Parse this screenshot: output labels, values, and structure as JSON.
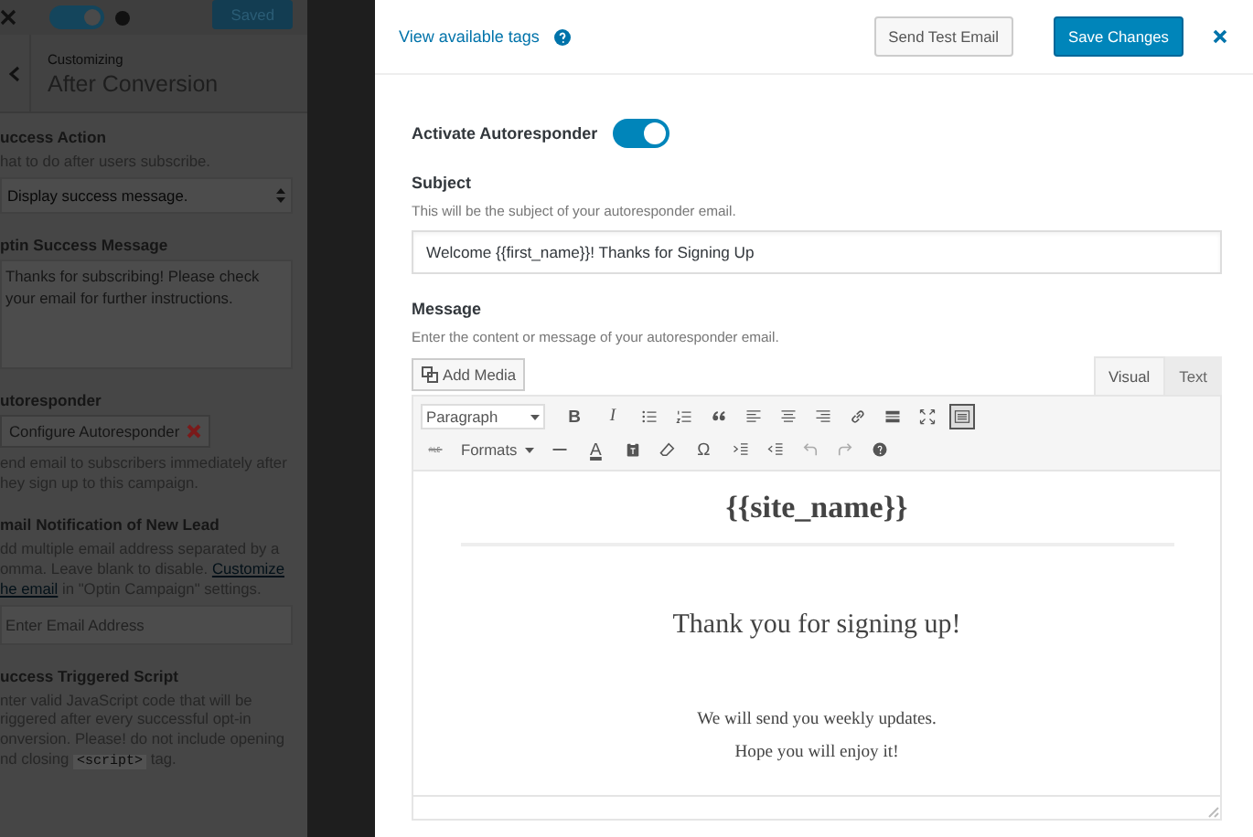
{
  "customizer": {
    "toggle": {
      "on": true
    },
    "saved_button": "Saved",
    "header": {
      "subtitle": "Customizing",
      "title": "After Conversion"
    },
    "fields": [
      {
        "kind": "select",
        "label": "uccess Action",
        "lines": [
          [
            {
              "kind": "text",
              "text": "hat to do after users subscribe."
            }
          ]
        ],
        "value": "Display success message."
      },
      {
        "kind": "textarea",
        "label": "ptin Success Message",
        "value": "Thanks for subscribing! Please check your email for further instructions."
      },
      {
        "kind": "button",
        "label": "utoresponder",
        "button": "Configure Autoresponder",
        "lines": [
          [
            {
              "kind": "text",
              "text": "end email to subscribers immediately after"
            }
          ],
          [
            {
              "kind": "text",
              "text": "hey sign up to this campaign."
            }
          ]
        ]
      },
      {
        "kind": "input",
        "label": "mail Notification of New Lead",
        "lines": [
          [
            {
              "kind": "text",
              "text": "dd multiple email address separated by a"
            }
          ],
          [
            {
              "kind": "text",
              "text": "omma. Leave blank to disable."
            },
            {
              "kind": "link",
              "text": "Customize"
            }
          ],
          [
            {
              "kind": "link",
              "text": "he email"
            },
            {
              "kind": "text",
              "text": "in \"Optin Campaign\" settings."
            }
          ]
        ],
        "placeholder": "Enter Email Address"
      },
      {
        "kind": "code",
        "label": "uccess Triggered Script",
        "lines": [
          [
            {
              "kind": "text",
              "text": "nter valid JavaScript code that will be"
            }
          ],
          [
            {
              "kind": "text",
              "text": "riggered after every successful opt-in"
            }
          ],
          [
            {
              "kind": "text",
              "text": "onversion. Please! do not include opening"
            }
          ],
          [
            {
              "kind": "text",
              "text": "nd closing"
            },
            {
              "kind": "code",
              "text": "<script>"
            },
            {
              "kind": "text",
              "text": "tag."
            }
          ]
        ]
      }
    ]
  },
  "modal": {
    "tags_link": "View available tags",
    "send_test_button": "Send Test Email",
    "save_button": "Save Changes",
    "activate": {
      "label": "Activate Autoresponder",
      "on": true
    },
    "subject": {
      "label": "Subject",
      "description": "This will be the subject of your autoresponder email.",
      "value": "Welcome {{first_name}}! Thanks for Signing Up"
    },
    "message": {
      "label": "Message",
      "description": "Enter the content or message of your autoresponder email.",
      "add_media_button": "Add Media",
      "tabs": [
        {
          "label": "Visual",
          "selected": true
        },
        {
          "label": "Text",
          "selected": false
        }
      ],
      "toolbar_rows": [
        [
          {
            "kind": "dropdown",
            "label": "Paragraph",
            "pressed": false
          },
          {
            "kind": "glyph",
            "label": "B",
            "pressed": false
          },
          {
            "kind": "glyph",
            "label": "I",
            "pressed": false
          },
          {
            "kind": "icon",
            "pressed": false
          },
          {
            "kind": "icon",
            "pressed": false
          },
          {
            "kind": "icon",
            "pressed": false
          },
          {
            "kind": "icon",
            "pressed": false
          },
          {
            "kind": "icon",
            "pressed": false
          },
          {
            "kind": "icon",
            "pressed": false
          },
          {
            "kind": "icon",
            "pressed": false
          },
          {
            "kind": "icon",
            "pressed": false
          },
          {
            "kind": "icon",
            "pressed": false
          },
          {
            "kind": "icon",
            "pressed": true
          }
        ],
        [
          {
            "kind": "icon",
            "pressed": false
          },
          {
            "kind": "dropdown",
            "label": "Formats",
            "pressed": false
          },
          {
            "kind": "icon",
            "pressed": false
          },
          {
            "kind": "glyph",
            "label": "A",
            "pressed": false
          },
          {
            "kind": "icon",
            "pressed": false
          },
          {
            "kind": "icon",
            "pressed": false
          },
          {
            "kind": "glyph",
            "label": "Ω",
            "pressed": false
          },
          {
            "kind": "icon",
            "pressed": false
          },
          {
            "kind": "icon",
            "pressed": false
          },
          {
            "kind": "icon",
            "pressed": false
          },
          {
            "kind": "icon",
            "pressed": false
          },
          {
            "kind": "icon",
            "pressed": false
          }
        ]
      ],
      "content": {
        "heading": "{{site_name}}",
        "lead": "Thank you for signing up!",
        "paragraphs": [
          "We will send you weekly updates.",
          "Hope you will enjoy it!"
        ]
      }
    }
  }
}
